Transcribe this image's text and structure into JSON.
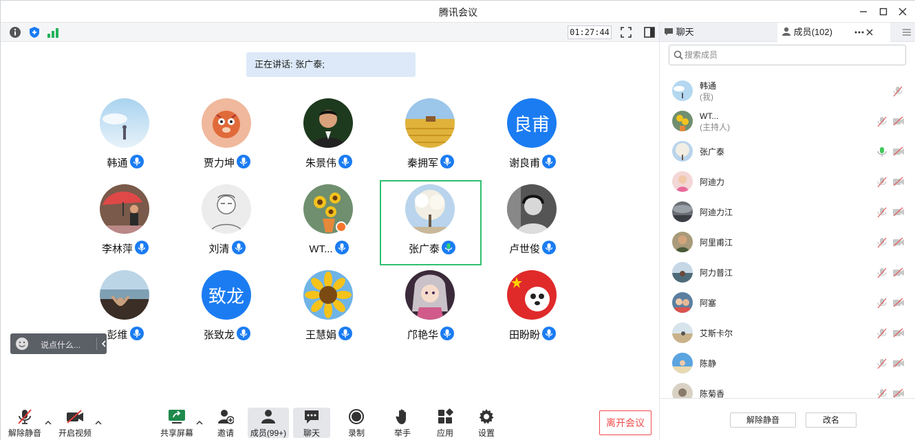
{
  "window": {
    "title": "腾讯会议"
  },
  "toolbar": {
    "timer": "01:27:44"
  },
  "banner": {
    "speaking": "正在讲话: 张广泰;"
  },
  "tiles": [
    {
      "name": "韩通",
      "avatar": "sky-photo"
    },
    {
      "name": "贾力坤",
      "avatar": "cartoon-tiger"
    },
    {
      "name": "朱景伟",
      "avatar": "man-photo"
    },
    {
      "name": "秦拥军",
      "avatar": "wheat-field"
    },
    {
      "name": "谢良甫",
      "avatar_text": "良甫"
    },
    {
      "name": "李林萍",
      "avatar": "woman-umbrella"
    },
    {
      "name": "刘清",
      "avatar": "sketch-portrait"
    },
    {
      "name": "WT...",
      "avatar": "sunflowers-vase",
      "host": true
    },
    {
      "name": "张广泰",
      "avatar": "white-tree",
      "active": true
    },
    {
      "name": "卢世俊",
      "avatar": "headset-man"
    },
    {
      "name": "彭维",
      "avatar": "beach-photo"
    },
    {
      "name": "张致龙",
      "avatar_text": "致龙"
    },
    {
      "name": "王慧娟",
      "avatar": "sunflower"
    },
    {
      "name": "邝艳华",
      "avatar": "anime-girl"
    },
    {
      "name": "田盼盼",
      "avatar": "flag-panda"
    }
  ],
  "chat_input": {
    "placeholder": "说点什么..."
  },
  "bottom_bar": {
    "unmute": "解除静音",
    "start_video": "开启视频",
    "share_screen": "共享屏幕",
    "invite": "邀请",
    "members": "成员(99+)",
    "chat": "聊天",
    "record": "录制",
    "raise_hand": "举手",
    "apps": "应用",
    "settings": "设置",
    "leave": "离开会议"
  },
  "panel": {
    "tab_chat": "聊天",
    "tab_members": "成员(102)",
    "search_placeholder": "搜索成员",
    "members": [
      {
        "name": "韩通",
        "sub": "(我)",
        "mic": "muted",
        "cam": "none",
        "avatar": "sky-photo"
      },
      {
        "name": "WT...",
        "sub": "(主持人)",
        "mic": "muted",
        "cam": "off",
        "avatar": "sunflowers-vase"
      },
      {
        "name": "张广泰",
        "sub": "",
        "mic": "speaking",
        "cam": "off",
        "avatar": "white-tree"
      },
      {
        "name": "阿迪力",
        "sub": "",
        "mic": "muted",
        "cam": "off",
        "avatar": "girl-pink"
      },
      {
        "name": "阿迪力江",
        "sub": "",
        "mic": "muted",
        "cam": "off",
        "avatar": "grey-cloud"
      },
      {
        "name": "阿里甫江",
        "sub": "",
        "mic": "muted",
        "cam": "off",
        "avatar": "man-photo-2"
      },
      {
        "name": "阿力普江",
        "sub": "",
        "mic": "muted",
        "cam": "off",
        "avatar": "lake-photo"
      },
      {
        "name": "阿塞",
        "sub": "",
        "mic": "muted",
        "cam": "off",
        "avatar": "kids-photo"
      },
      {
        "name": "艾斯卡尔",
        "sub": "",
        "mic": "muted",
        "cam": "off",
        "avatar": "desert-photo"
      },
      {
        "name": "陈静",
        "sub": "",
        "mic": "muted",
        "cam": "off",
        "avatar": "blue-sky-girl"
      },
      {
        "name": "陈菊香",
        "sub": "",
        "mic": "muted",
        "cam": "off",
        "avatar": "sunset-photo"
      }
    ],
    "unmute_button": "解除静音",
    "rename_button": "改名"
  },
  "colors": {
    "accent": "#1b7cf2",
    "active_border": "#2fbf71",
    "leave": "#f04b4b",
    "muted_icon": "#e06060"
  }
}
